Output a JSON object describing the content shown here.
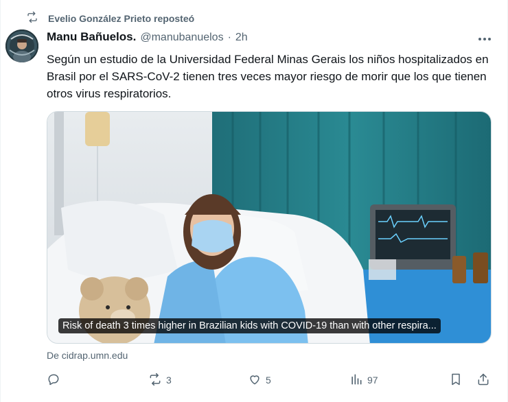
{
  "repost": {
    "text": "Evelio González Prieto reposteó",
    "icon": "repost-icon"
  },
  "tweet": {
    "author_name": "Manu Bañuelos.",
    "author_handle": "@manubanuelos",
    "separator": "·",
    "time": "2h",
    "text": "Según un estudio de la Universidad Federal Minas Gerais los niños hospitalizados en Brasil por el SARS-CoV-2 tienen tres veces mayor riesgo de morir que los que tienen otros virus respiratorios."
  },
  "media": {
    "caption": "Risk of death 3 times higher in Brazilian kids with COVID-19 than with other respira..."
  },
  "source": {
    "text": "De cidrap.umn.edu"
  },
  "actions": {
    "reply": {
      "icon": "reply-icon",
      "count": ""
    },
    "retweet": {
      "icon": "retweet-icon",
      "count": "3"
    },
    "like": {
      "icon": "heart-icon",
      "count": "5"
    },
    "views": {
      "icon": "views-icon",
      "count": "97"
    },
    "bookmark": {
      "icon": "bookmark-icon"
    },
    "share": {
      "icon": "share-icon"
    }
  },
  "colors": {
    "text_primary": "#0f1419",
    "text_secondary": "#536471",
    "border": "#cfd9de"
  }
}
